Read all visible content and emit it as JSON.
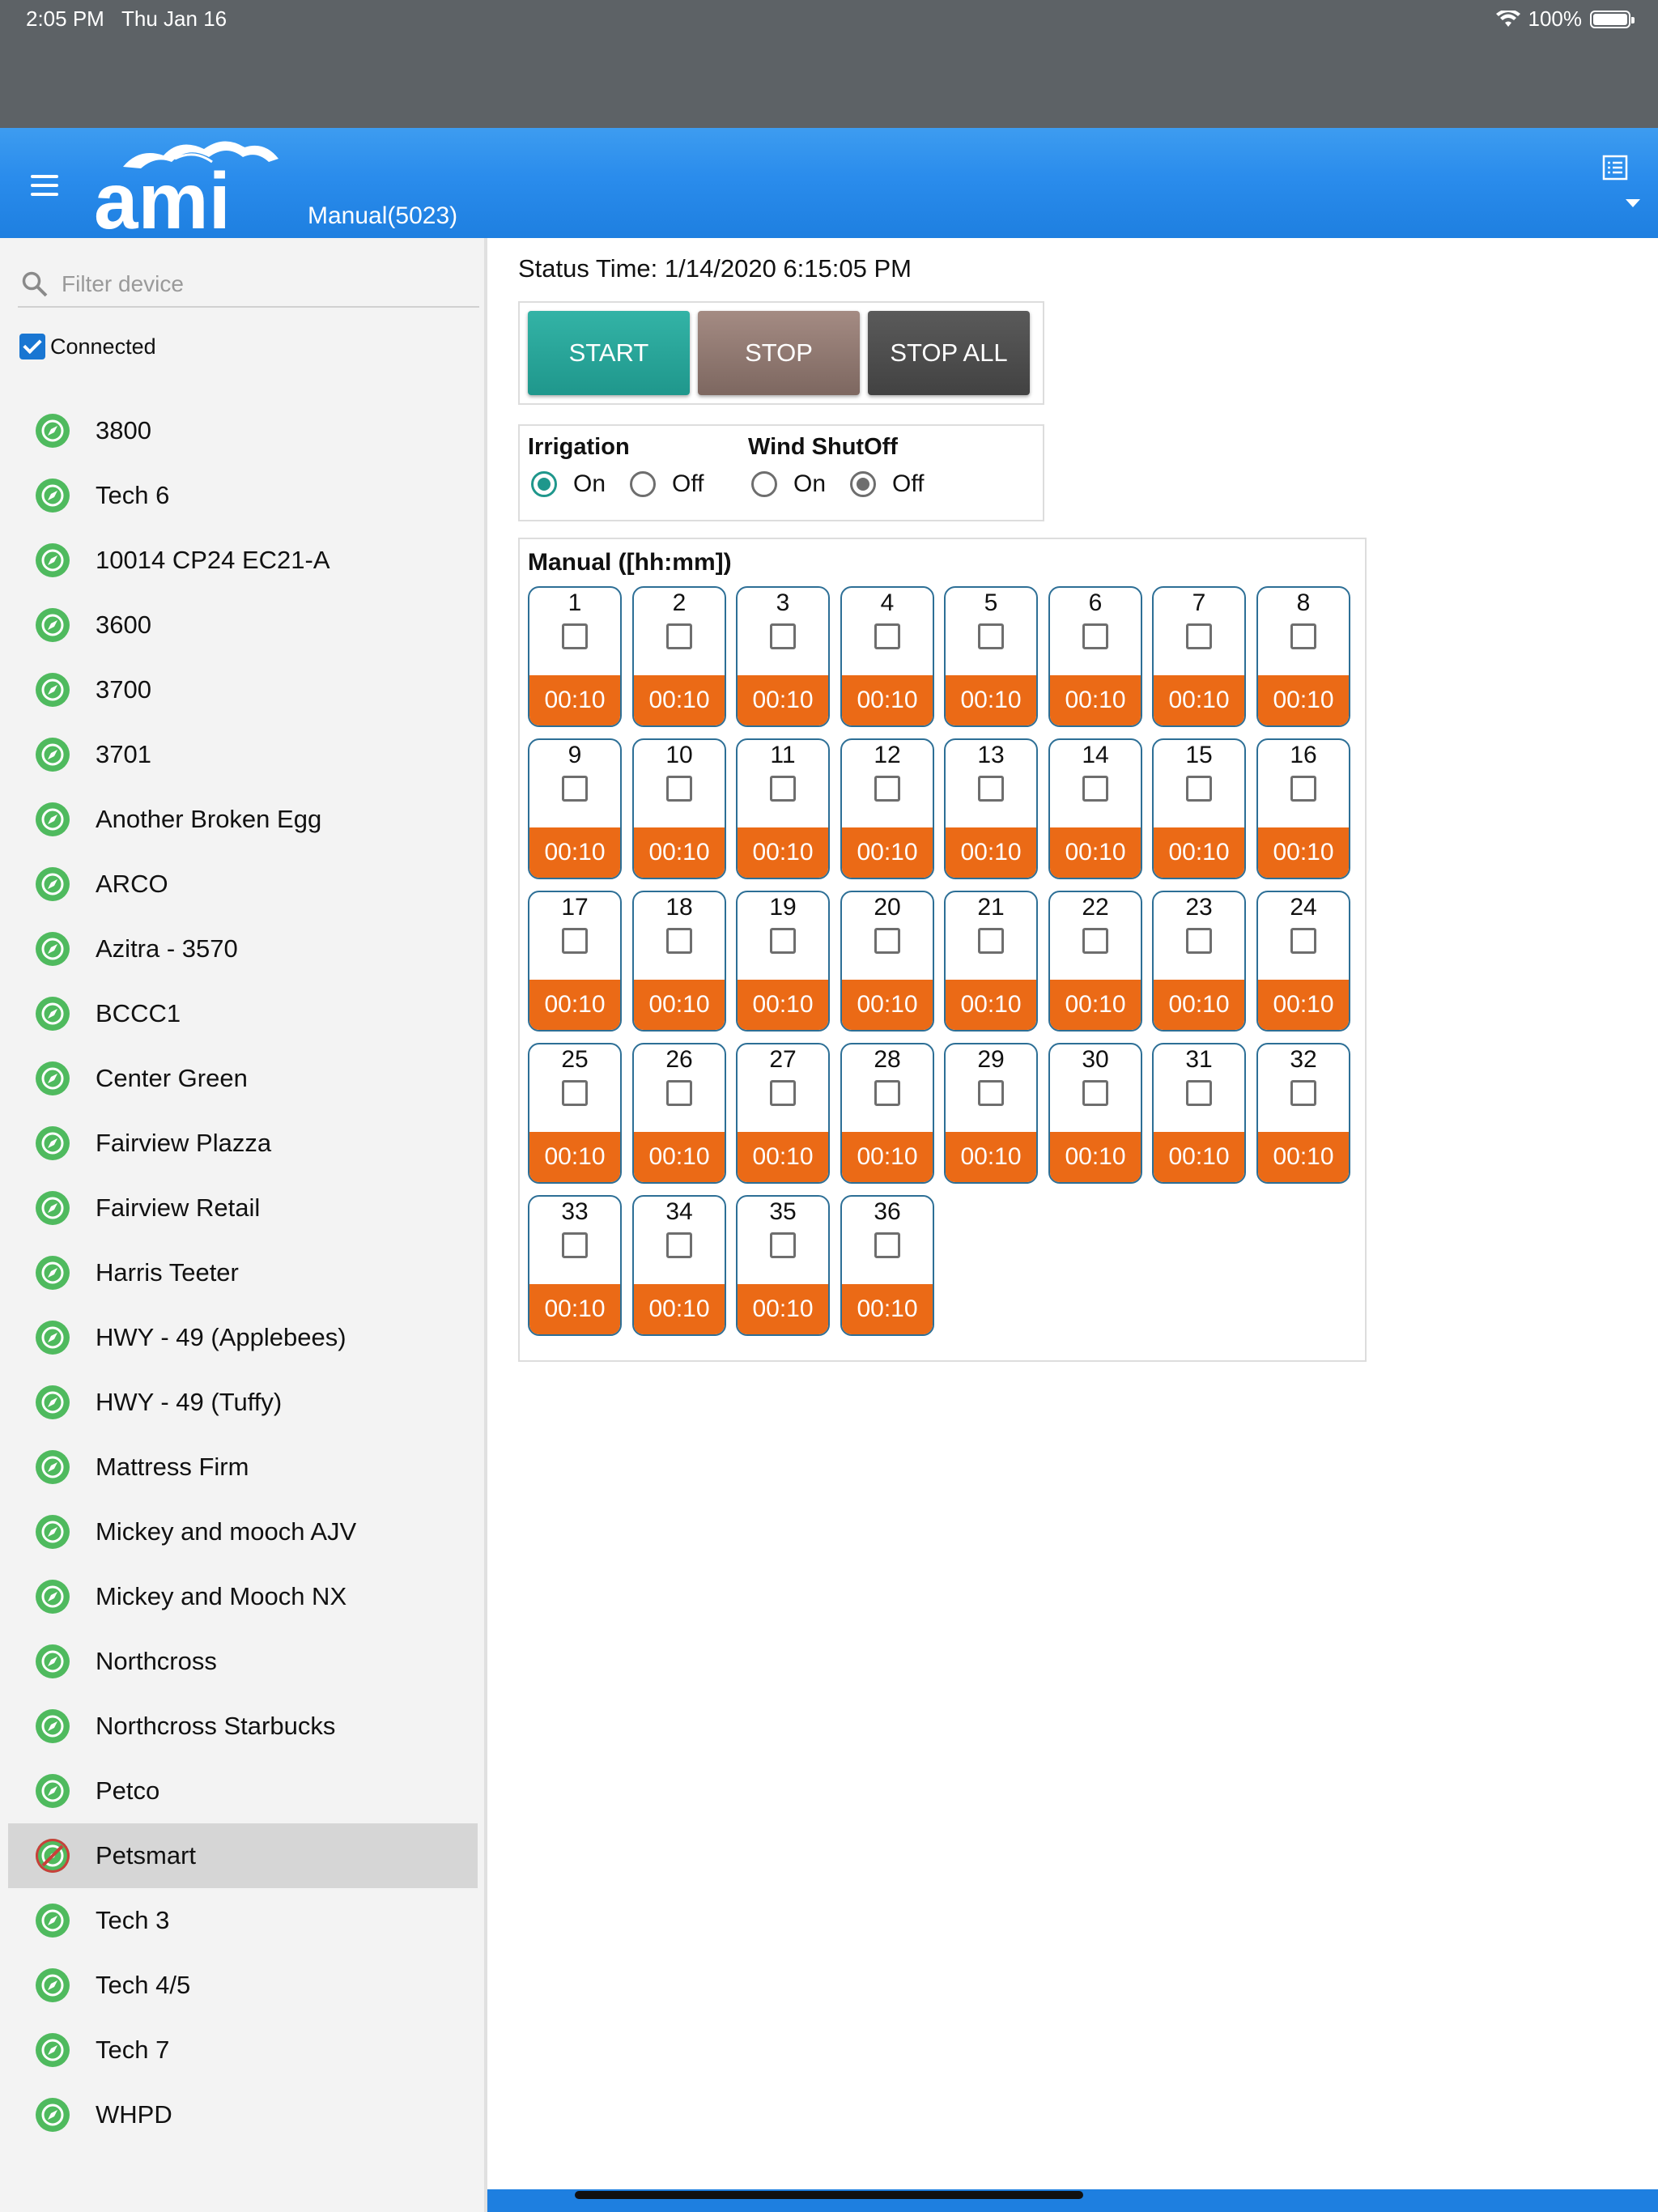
{
  "status_bar": {
    "time": "2:05 PM",
    "date": "Thu Jan 16",
    "battery": "100%"
  },
  "header": {
    "logo_text": "ami",
    "device_title": "Manual(5023)"
  },
  "sidebar": {
    "filter_placeholder": "Filter device",
    "connected_label": "Connected",
    "connected_checked": true,
    "devices": [
      "3800",
      "Tech 6",
      "10014 CP24 EC21-A",
      "3600",
      "3700",
      "3701",
      "Another Broken Egg",
      "ARCO",
      "Azitra - 3570",
      "BCCC1",
      "Center Green",
      "Fairview Plazza",
      "Fairview Retail",
      "Harris Teeter",
      "HWY - 49 (Applebees)",
      "HWY - 49 (Tuffy)",
      "Mattress Firm",
      "Mickey and mooch AJV",
      "Mickey and Mooch NX",
      "Northcross",
      "Northcross Starbucks",
      "Petco",
      "Petsmart",
      "Tech 3",
      "Tech 4/5",
      "Tech 7",
      "WHPD"
    ],
    "selected_device": "Petsmart"
  },
  "main": {
    "status_time": "Status Time: 1/14/2020 6:15:05 PM",
    "buttons": {
      "start": "START",
      "stop": "STOP",
      "stop_all": "STOP ALL"
    },
    "irrigation": {
      "label": "Irrigation",
      "on": "On",
      "off": "Off",
      "value": "On"
    },
    "wind_shutoff": {
      "label": "Wind ShutOff",
      "on": "On",
      "off": "Off",
      "value": "Off"
    },
    "manual": {
      "title": "Manual ([hh:mm])",
      "zones": [
        {
          "n": "1",
          "d": "00:10"
        },
        {
          "n": "2",
          "d": "00:10"
        },
        {
          "n": "3",
          "d": "00:10"
        },
        {
          "n": "4",
          "d": "00:10"
        },
        {
          "n": "5",
          "d": "00:10"
        },
        {
          "n": "6",
          "d": "00:10"
        },
        {
          "n": "7",
          "d": "00:10"
        },
        {
          "n": "8",
          "d": "00:10"
        },
        {
          "n": "9",
          "d": "00:10"
        },
        {
          "n": "10",
          "d": "00:10"
        },
        {
          "n": "11",
          "d": "00:10"
        },
        {
          "n": "12",
          "d": "00:10"
        },
        {
          "n": "13",
          "d": "00:10"
        },
        {
          "n": "14",
          "d": "00:10"
        },
        {
          "n": "15",
          "d": "00:10"
        },
        {
          "n": "16",
          "d": "00:10"
        },
        {
          "n": "17",
          "d": "00:10"
        },
        {
          "n": "18",
          "d": "00:10"
        },
        {
          "n": "19",
          "d": "00:10"
        },
        {
          "n": "20",
          "d": "00:10"
        },
        {
          "n": "21",
          "d": "00:10"
        },
        {
          "n": "22",
          "d": "00:10"
        },
        {
          "n": "23",
          "d": "00:10"
        },
        {
          "n": "24",
          "d": "00:10"
        },
        {
          "n": "25",
          "d": "00:10"
        },
        {
          "n": "26",
          "d": "00:10"
        },
        {
          "n": "27",
          "d": "00:10"
        },
        {
          "n": "28",
          "d": "00:10"
        },
        {
          "n": "29",
          "d": "00:10"
        },
        {
          "n": "30",
          "d": "00:10"
        },
        {
          "n": "31",
          "d": "00:10"
        },
        {
          "n": "32",
          "d": "00:10"
        },
        {
          "n": "33",
          "d": "00:10"
        },
        {
          "n": "34",
          "d": "00:10"
        },
        {
          "n": "35",
          "d": "00:10"
        },
        {
          "n": "36",
          "d": "00:10"
        }
      ]
    }
  },
  "colors": {
    "header_blue": "#2a8cec",
    "start_teal": "#1f978c",
    "stop_brown": "#7d6760",
    "stop_all_gray": "#424242",
    "duration_orange": "#eb6a16",
    "device_online": "#4fba5e",
    "device_offline": "#c9403a"
  },
  "icons": {
    "menu": "menu-icon",
    "list": "list-view-icon",
    "search": "search-icon",
    "device_status": "compass-icon"
  }
}
